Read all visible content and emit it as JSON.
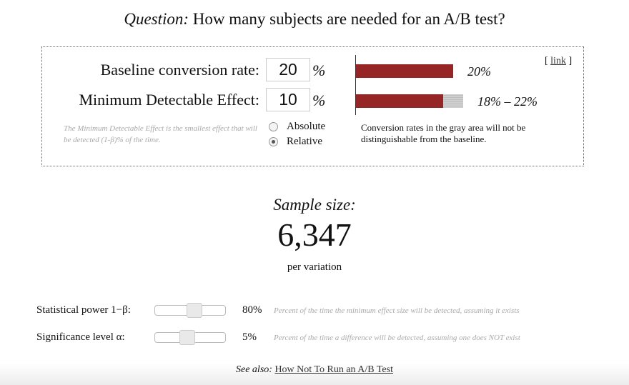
{
  "title": {
    "prefix": "Question:",
    "text": " How many subjects are needed for an A/B test?"
  },
  "inputs": {
    "baseline_label": "Baseline conversion rate:",
    "baseline_value": "20",
    "mde_label": "Minimum Detectable Effect:",
    "mde_value": "10",
    "percent_sign": "%",
    "mde_note": "The Minimum Detectable Effect is the smallest effect that will be detected (1-β)% of the time.",
    "mode_options": [
      "Absolute",
      "Relative"
    ],
    "mode_selected": "Relative"
  },
  "visual": {
    "baseline_fraction": 0.2,
    "range_low_fraction": 0.18,
    "range_high_fraction": 0.22,
    "baseline_label": "20%",
    "range_label": "18% – 22%",
    "gray_note": "Conversion rates in the gray area will not be distinguishable from the baseline.",
    "link_text": "link",
    "link_prefix": "[ ",
    "link_suffix": " ]",
    "colors": {
      "bar": "#962626",
      "gray_area": "#c8c8c8"
    }
  },
  "result": {
    "label": "Sample size:",
    "value": "6,347",
    "unit": "per variation"
  },
  "sliders": [
    {
      "label": "Statistical power 1−β:",
      "value_label": "80%",
      "position_fraction": 0.58,
      "description": "Percent of the time the minimum effect size will be detected, assuming it exists"
    },
    {
      "label": "Significance level α:",
      "value_label": "5%",
      "position_fraction": 0.45,
      "description": "Percent of the time a difference will be detected, assuming one does NOT exist"
    }
  ],
  "footer": {
    "see_also_label": "See also:",
    "see_also_link": "How Not To Run an A/B Test"
  }
}
